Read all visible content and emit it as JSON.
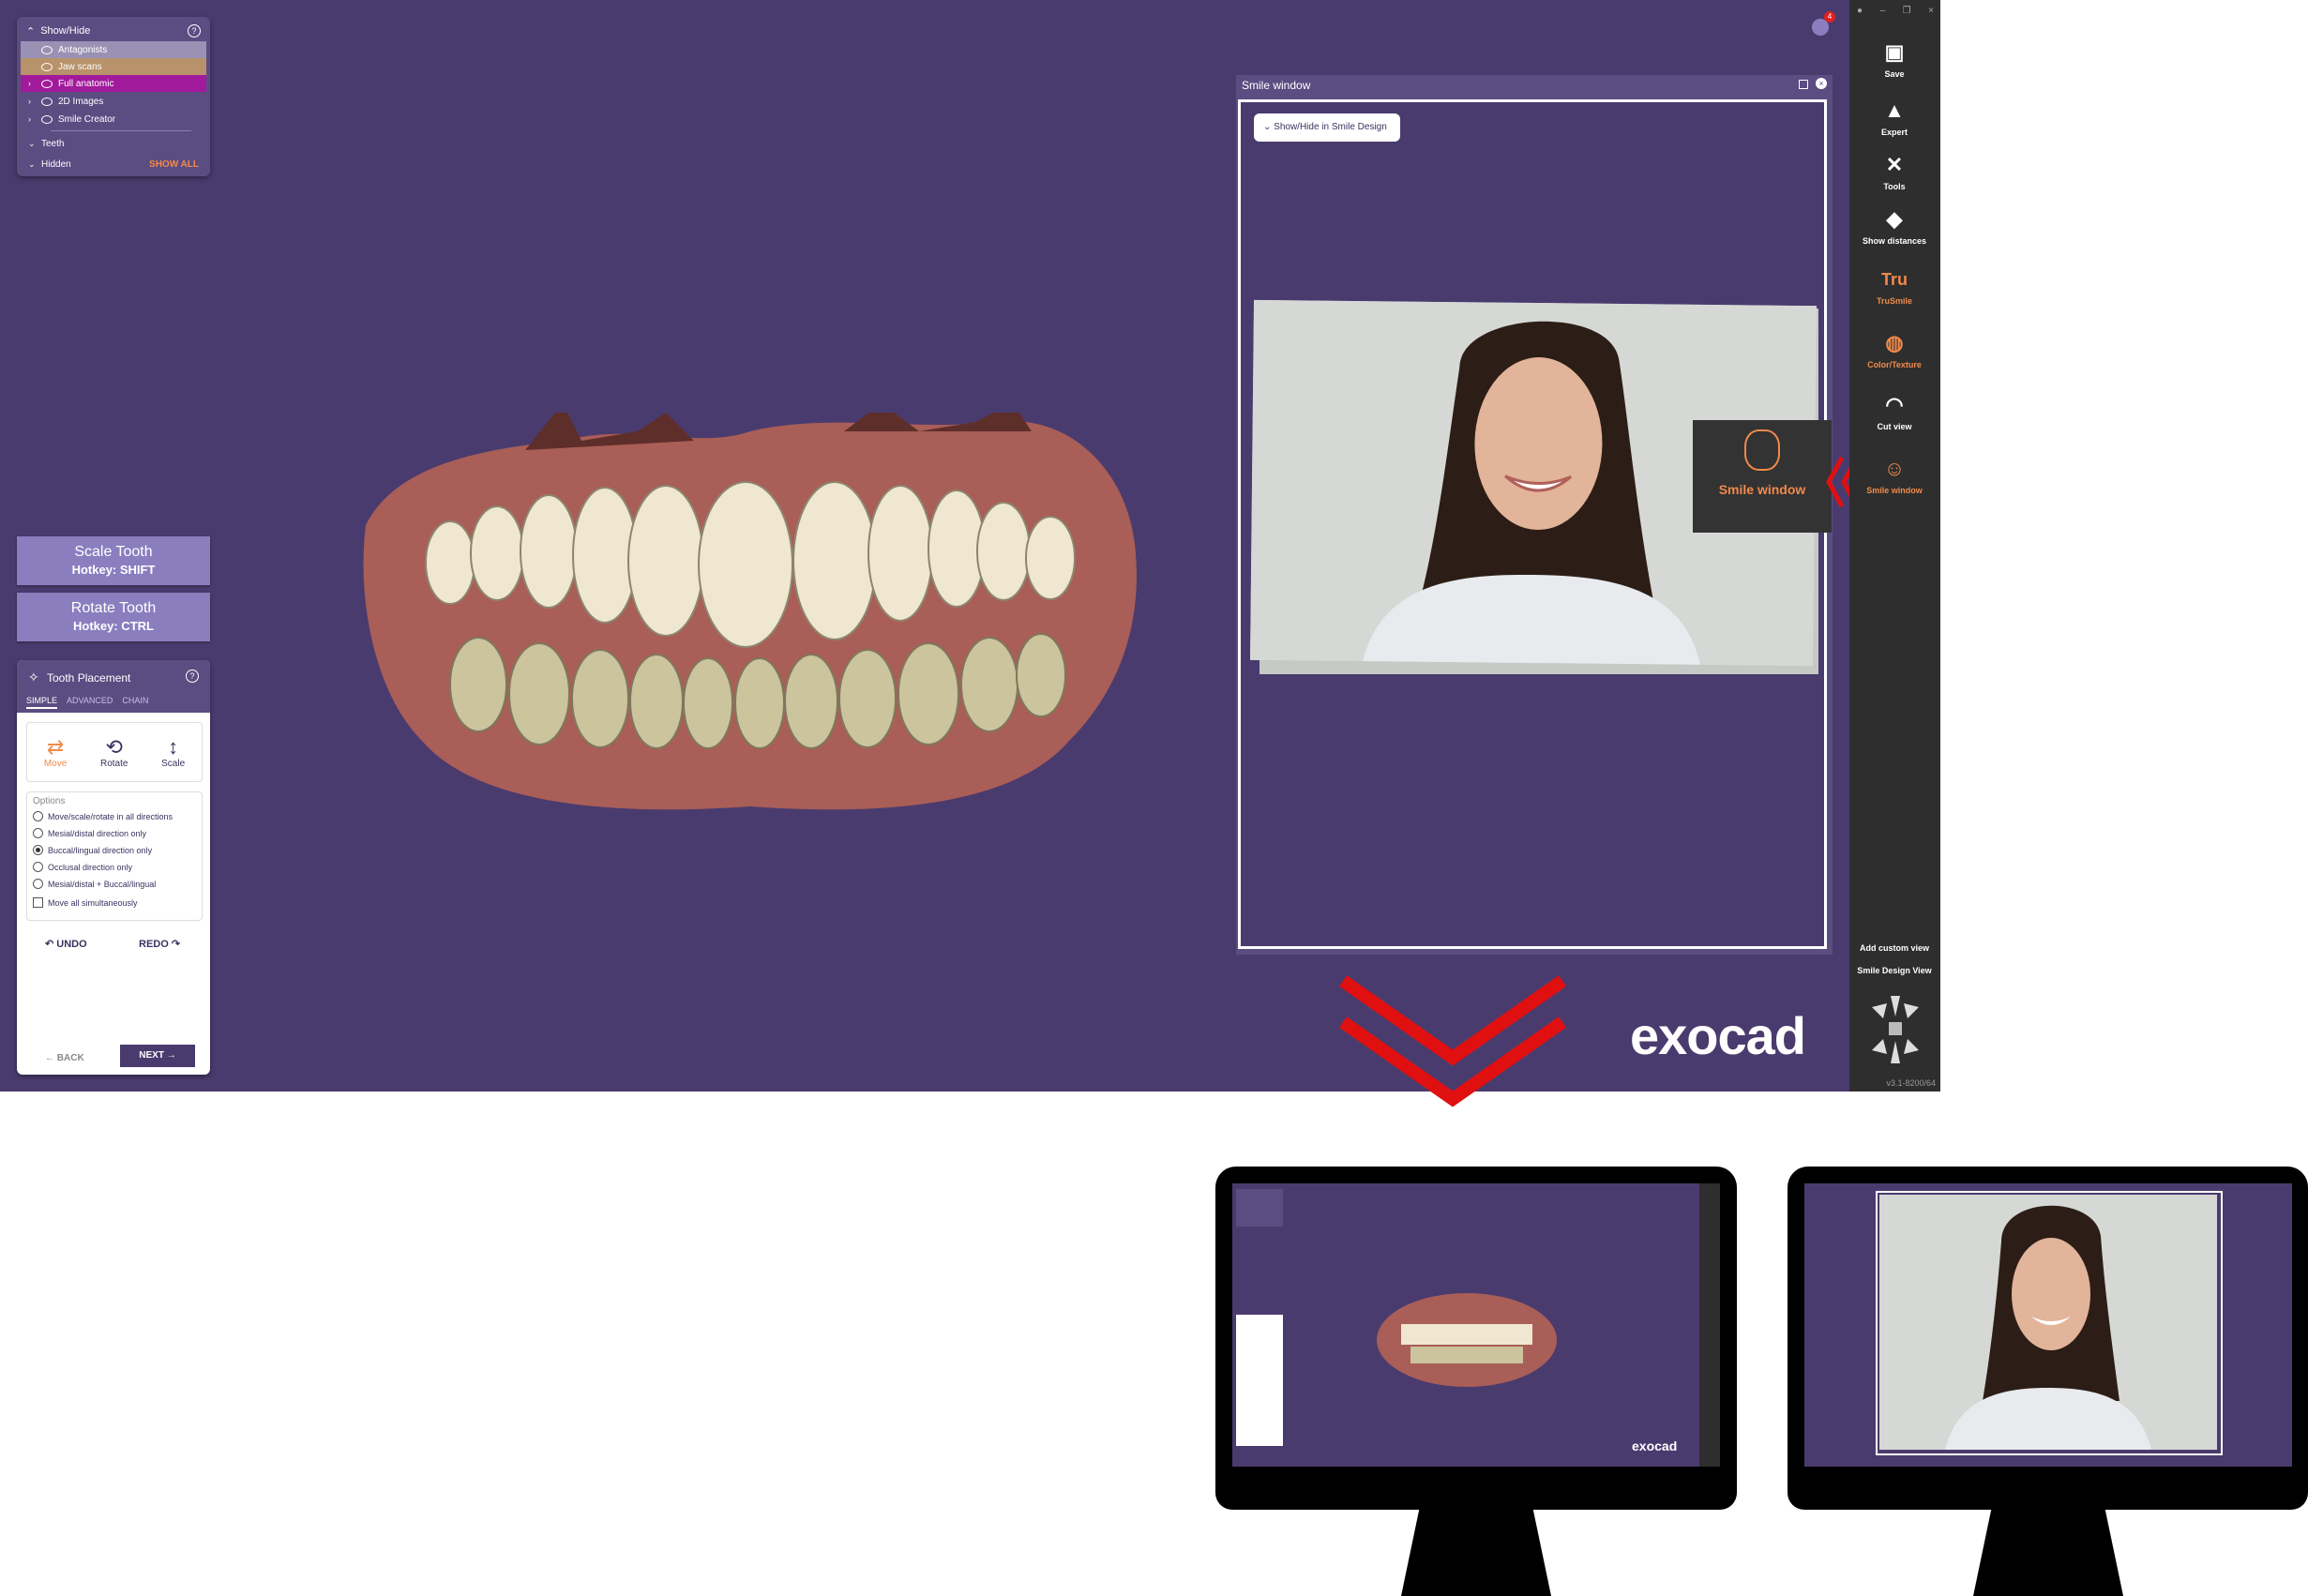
{
  "show_hide": {
    "title": "Show/Hide",
    "rows": [
      {
        "label": "Antagonists"
      },
      {
        "label": "Jaw scans"
      },
      {
        "label": "Full anatomic"
      },
      {
        "label": "2D Images"
      },
      {
        "label": "Smile Creator"
      }
    ],
    "teeth": "Teeth",
    "hidden": "Hidden",
    "show_all": "SHOW ALL"
  },
  "scale_button": {
    "label": "Scale Tooth",
    "hotkey": "Hotkey: SHIFT"
  },
  "rotate_button": {
    "label": "Rotate Tooth",
    "hotkey": "Hotkey: CTRL"
  },
  "tooth_placement": {
    "title": "Tooth Placement",
    "tabs": [
      "SIMPLE",
      "ADVANCED",
      "CHAIN"
    ],
    "modes": [
      "Move",
      "Rotate",
      "Scale"
    ],
    "options_label": "Options",
    "options": [
      "Move/scale/rotate in all directions",
      "Mesial/distal direction only",
      "Buccal/lingual direction only",
      "Occlusal direction only",
      "Mesial/distal + Buccal/lingual"
    ],
    "selected_option": 2,
    "checkbox": "Move all simultaneously",
    "undo": "UNDO",
    "redo": "REDO",
    "back": "BACK",
    "next": "NEXT"
  },
  "smile_window": {
    "title": "Smile window",
    "toggle": "Show/Hide in Smile Design"
  },
  "tooltip": {
    "label": "Smile window"
  },
  "toolbar": {
    "items": [
      {
        "label": "Save"
      },
      {
        "label": "Expert"
      },
      {
        "label": "Tools"
      },
      {
        "label": "Show distances"
      },
      {
        "label": "TruSmile"
      },
      {
        "label": "Color/Texture"
      },
      {
        "label": "Cut view"
      },
      {
        "label": "Smile window"
      }
    ],
    "add_custom_view": "Add custom view",
    "smile_design_view": "Smile Design View",
    "version": "v3.1-8200/64",
    "tru_glyph": "Tru"
  },
  "notification_count": "4",
  "logo": "exocad",
  "mini_logo": "exocad",
  "colors": {
    "bg": "#4a3b6e",
    "accent": "#f08a4b",
    "arrow": "#e01010"
  }
}
